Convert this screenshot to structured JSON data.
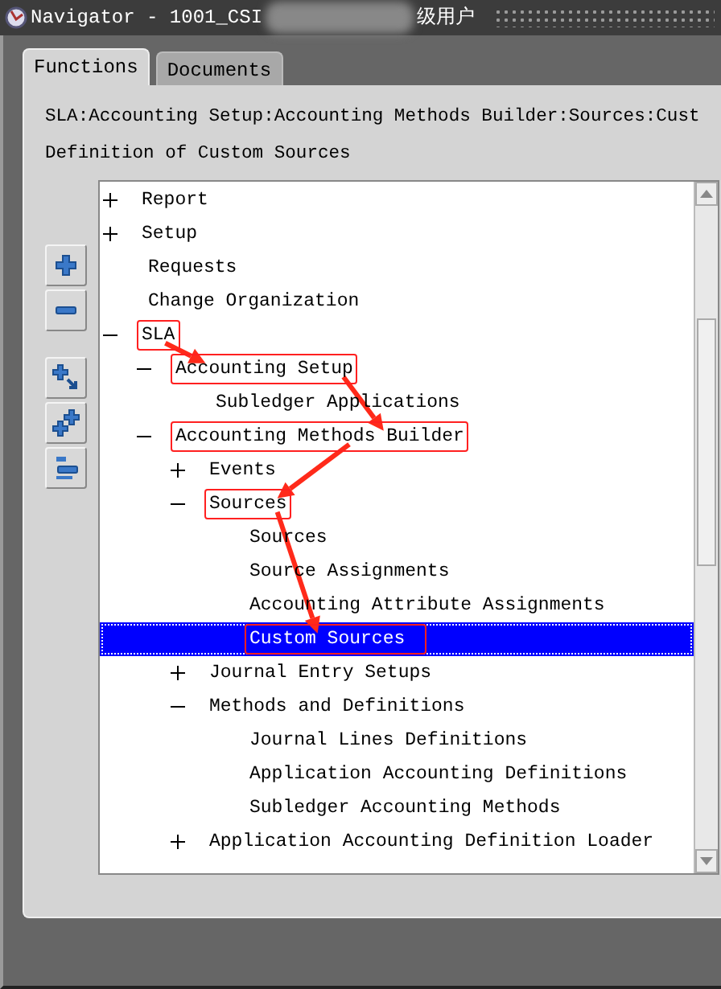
{
  "window": {
    "title_parts": [
      "Navigator - 1001_CSI",
      "级用户"
    ]
  },
  "tabs": [
    {
      "label": "Functions",
      "selected": true
    },
    {
      "label": "Documents",
      "selected": false
    }
  ],
  "breadcrumb": "SLA:Accounting Setup:Accounting Methods Builder:Sources:Cust",
  "description": "Definition of Custom Sources",
  "tree": [
    {
      "label": "Report",
      "expanded": false,
      "selected": false,
      "highlighted": false
    },
    {
      "label": "Setup",
      "expanded": false,
      "selected": false,
      "highlighted": false
    },
    {
      "label": "Requests",
      "selected": false,
      "highlighted": false
    },
    {
      "label": "Change Organization",
      "selected": false,
      "highlighted": false
    },
    {
      "label": "SLA",
      "expanded": true,
      "selected": false,
      "highlighted": true,
      "children": [
        {
          "label": "Accounting Setup",
          "expanded": true,
          "selected": false,
          "highlighted": true,
          "children": [
            {
              "label": "Subledger Applications",
              "selected": false,
              "highlighted": false
            }
          ]
        },
        {
          "label": "Accounting Methods Builder",
          "expanded": true,
          "selected": false,
          "highlighted": true,
          "children": [
            {
              "label": "Events",
              "expanded": false,
              "selected": false,
              "highlighted": false
            },
            {
              "label": "Sources",
              "expanded": true,
              "selected": false,
              "highlighted": true,
              "children": [
                {
                  "label": "Sources",
                  "selected": false,
                  "highlighted": false
                },
                {
                  "label": "Source Assignments",
                  "selected": false,
                  "highlighted": false
                },
                {
                  "label": "Accounting Attribute Assignments",
                  "selected": false,
                  "highlighted": false
                },
                {
                  "label": "Custom Sources",
                  "selected": true,
                  "highlighted": true
                }
              ]
            },
            {
              "label": "Journal Entry Setups",
              "expanded": false,
              "selected": false,
              "highlighted": false
            },
            {
              "label": "Methods and Definitions",
              "expanded": true,
              "selected": false,
              "highlighted": false,
              "children": [
                {
                  "label": "Journal Lines Definitions",
                  "selected": false,
                  "highlighted": false
                },
                {
                  "label": "Application Accounting Definitions",
                  "selected": false,
                  "highlighted": false
                },
                {
                  "label": "Subledger Accounting Methods",
                  "selected": false,
                  "highlighted": false
                }
              ]
            },
            {
              "label": "Application Accounting Definition Loader",
              "expanded": false,
              "selected": false,
              "highlighted": false
            }
          ]
        }
      ]
    }
  ]
}
